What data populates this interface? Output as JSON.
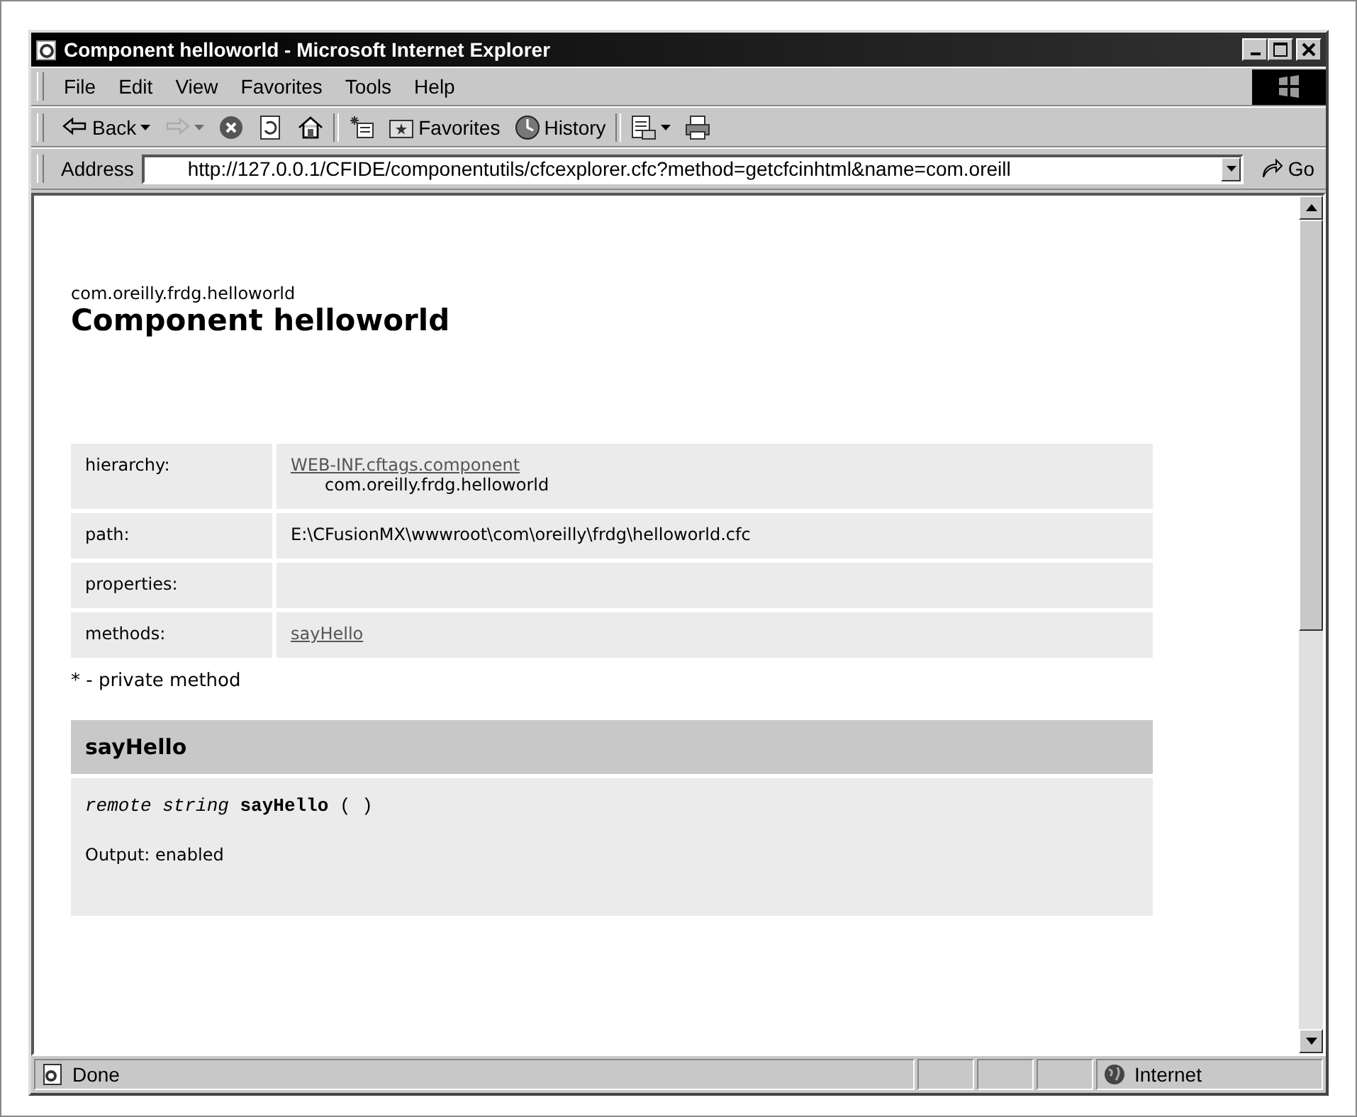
{
  "window": {
    "title": "Component helloworld - Microsoft Internet Explorer"
  },
  "menu": [
    "File",
    "Edit",
    "View",
    "Favorites",
    "Tools",
    "Help"
  ],
  "toolbar": [
    {
      "kind": "back",
      "label": "Back",
      "dropdown": true,
      "disabled": false
    },
    {
      "kind": "forward",
      "dropdown": true,
      "disabled": true
    },
    {
      "kind": "stop",
      "disabled": false
    },
    {
      "kind": "refresh",
      "disabled": false
    },
    {
      "kind": "home",
      "disabled": false
    },
    {
      "kind": "separator"
    },
    {
      "kind": "search",
      "disabled": false
    },
    {
      "kind": "favorites",
      "label": "Favorites",
      "disabled": false
    },
    {
      "kind": "history",
      "label": "History",
      "disabled": false
    },
    {
      "kind": "separator"
    },
    {
      "kind": "mail",
      "dropdown": true,
      "disabled": false
    },
    {
      "kind": "print",
      "disabled": false
    }
  ],
  "address": {
    "label": "Address",
    "value": "http://127.0.0.1/CFIDE/componentutils/cfcexplorer.cfc?method=getcfcinhtml&name=com.oreill",
    "go": "Go"
  },
  "page": {
    "package": "com.oreilly.frdg.helloworld",
    "title": "Component helloworld",
    "info": [
      {
        "label": "hierarchy:",
        "lines": [
          {
            "kind": "link",
            "text": "WEB-INF.cftags.component"
          },
          {
            "kind": "indented",
            "text": "com.oreilly.frdg.helloworld"
          }
        ]
      },
      {
        "label": "path:",
        "lines": [
          {
            "kind": "text",
            "text": "E:\\CFusionMX\\wwwroot\\com\\oreilly\\frdg\\helloworld.cfc"
          }
        ]
      },
      {
        "label": "properties:"
      },
      {
        "label": "methods:",
        "lines": [
          {
            "kind": "link",
            "text": "sayHello"
          }
        ]
      }
    ],
    "note": "* - private method",
    "methods": [
      {
        "name": "sayHello",
        "access": "remote",
        "returns": "string",
        "signature_name": "sayHello",
        "args": "( )",
        "output": "Output: enabled"
      }
    ]
  },
  "status_bar": {
    "text": "Done",
    "zone": "Internet"
  }
}
